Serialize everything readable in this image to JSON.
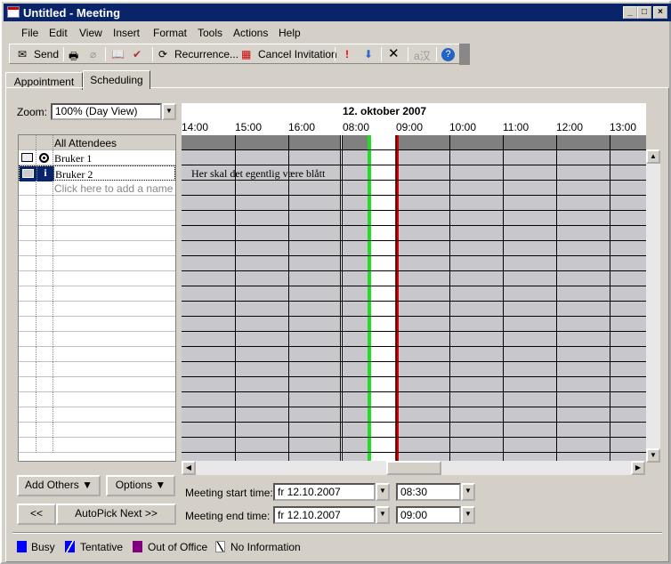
{
  "window": {
    "title": "Untitled - Meeting"
  },
  "menu": [
    "File",
    "Edit",
    "View",
    "Insert",
    "Format",
    "Tools",
    "Actions",
    "Help"
  ],
  "toolbar": {
    "send": "Send",
    "recurrence": "Recurrence...",
    "cancel_invitation": "Cancel Invitation"
  },
  "tabs": [
    "Appointment",
    "Scheduling"
  ],
  "zoom": {
    "label": "Zoom:",
    "value": "100% (Day View)"
  },
  "attendees": {
    "header": "All Attendees",
    "rows": [
      {
        "name": "Bruker 1"
      },
      {
        "name": "Bruker 2"
      }
    ],
    "add_placeholder": "Click here to add a name"
  },
  "schedule": {
    "date": "12. oktober 2007",
    "prev_times": [
      "14:00",
      "15:00",
      "16:00"
    ],
    "times": [
      "08:00",
      "09:00",
      "10:00",
      "11:00",
      "12:00",
      "13:00"
    ],
    "note": "Her skal det egentlig være blått",
    "meeting_start": "08:30",
    "meeting_end": "09:00"
  },
  "buttons": {
    "add_others": "Add Others",
    "options": "Options",
    "prev": "<<",
    "autopick": "AutoPick Next >>"
  },
  "meeting": {
    "start_label": "Meeting start time:",
    "start_date": "fr 12.10.2007",
    "start_time": "08:30",
    "end_label": "Meeting end time:",
    "end_date": "fr 12.10.2007",
    "end_time": "09:00"
  },
  "legend": [
    {
      "label": "Busy",
      "color": "#0000ff"
    },
    {
      "label": "Tentative",
      "color": "#0000ff"
    },
    {
      "label": "Out of Office",
      "color": "#800080"
    },
    {
      "label": "No Information",
      "color": "#ffffff"
    }
  ]
}
